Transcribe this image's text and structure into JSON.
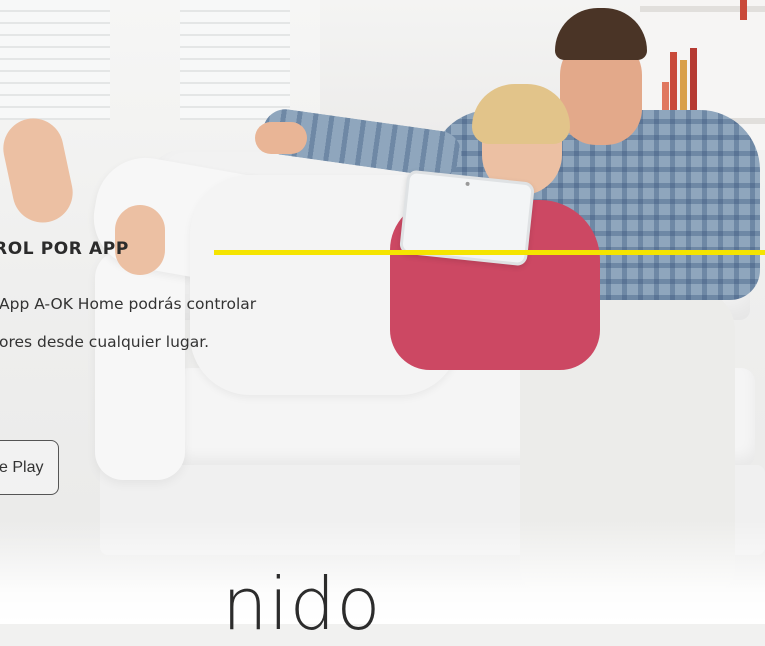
{
  "hero": {
    "image_subject": "couple-on-sofa-with-tablet",
    "colors": {
      "accent": "#f5e400",
      "text": "#333333"
    }
  },
  "feature": {
    "title": "ROL POR APP",
    "description_lines": [
      "App A-OK Home podrás controlar",
      "ores desde cualquier lugar."
    ]
  },
  "store_badge": {
    "label": "e Play",
    "icon": "google-play-icon"
  },
  "heading": {
    "text": "nido"
  }
}
